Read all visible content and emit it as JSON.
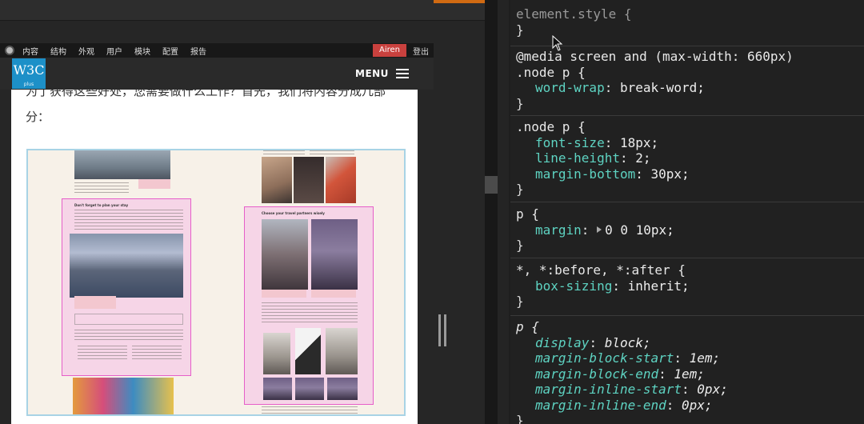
{
  "admin_bar": {
    "nav": [
      "内容",
      "结构",
      "外观",
      "用户",
      "模块",
      "配置",
      "报告"
    ],
    "user": "Airen",
    "logout": "登出"
  },
  "site_header": {
    "logo_text": "W3C",
    "logo_sub": "plus",
    "menu_label": "MENU"
  },
  "article": {
    "line1": "为了获得这些好处，您需要做什么工作？首先，我们将内容分成几部",
    "line2": "分："
  },
  "figure": {
    "heading_left": "Don't forget to plan your stay",
    "heading_right": "Choose your travel partners wisely"
  },
  "styles_panel": {
    "rules": [
      {
        "selector": "element.style {",
        "decls": []
      },
      {
        "at_rule": "@media screen and (max-width: 660px)",
        "selector": ".node p {",
        "decls": [
          {
            "prop": "word-wrap",
            "value": "break-word;"
          }
        ]
      },
      {
        "selector": ".node p {",
        "decls": [
          {
            "prop": "font-size",
            "value": "18px;"
          },
          {
            "prop": "line-height",
            "value": "2;"
          },
          {
            "prop": "margin-bottom",
            "value": "30px;"
          }
        ]
      },
      {
        "selector": "p {",
        "decls": [
          {
            "prop": "margin",
            "value": "0 0 10px;"
          }
        ]
      },
      {
        "selector": "*, *:before, *:after {",
        "decls": [
          {
            "prop": "box-sizing",
            "value": "inherit;"
          }
        ]
      },
      {
        "selector": "p {",
        "decls": [
          {
            "prop": "display",
            "value": "block;"
          },
          {
            "prop": "margin-block-start",
            "value": "1em;"
          },
          {
            "prop": "margin-block-end",
            "value": "1em;"
          },
          {
            "prop": "margin-inline-start",
            "value": "0px;"
          },
          {
            "prop": "margin-inline-end",
            "value": "0px;"
          }
        ]
      }
    ],
    "close_brace": "}"
  },
  "colors": {
    "admin_user_bg": "#c9413e",
    "logo_bg": "#1d90c8",
    "css_property": "#5ed3c2",
    "figure_outline": "#e65fc9"
  }
}
